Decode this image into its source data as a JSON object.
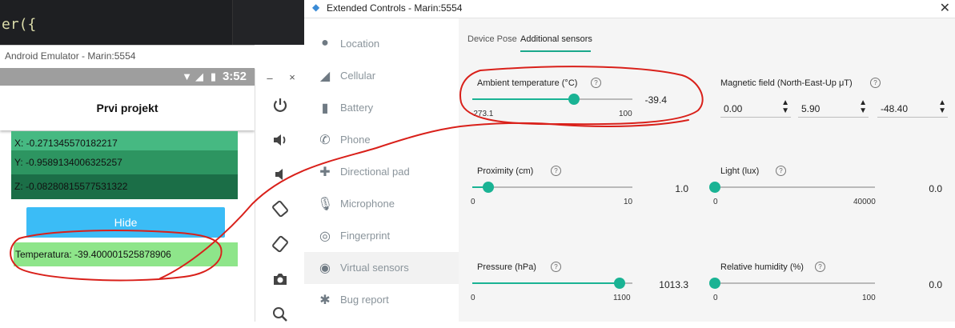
{
  "editor": {
    "code_text": "er({"
  },
  "emulator": {
    "title": "Android Emulator - Marin:5554",
    "status_time": "3:52",
    "app_title": "Prvi projekt",
    "rows": {
      "x": "X: -0.271345570182217",
      "y": "Y: -0.9589134006325257",
      "z": "Z: -0.08280815577531322"
    },
    "hide_button": "Hide",
    "temperature_text": "Temperatura: -39.400001525878906"
  },
  "toolbar": {
    "minimize": "–",
    "close": "×",
    "icons": [
      "power-icon",
      "volume-up-icon",
      "volume-down-icon",
      "rotate-left-icon",
      "rotate-right-icon",
      "camera-icon",
      "zoom-icon"
    ]
  },
  "extended": {
    "title": "Extended Controls - Marin:5554",
    "close": "✕",
    "sidebar": [
      {
        "label": "Location",
        "icon": "location-pin-icon"
      },
      {
        "label": "Cellular",
        "icon": "signal-icon"
      },
      {
        "label": "Battery",
        "icon": "battery-icon"
      },
      {
        "label": "Phone",
        "icon": "phone-icon"
      },
      {
        "label": "Directional pad",
        "icon": "dpad-icon"
      },
      {
        "label": "Microphone",
        "icon": "microphone-icon"
      },
      {
        "label": "Fingerprint",
        "icon": "fingerprint-icon"
      },
      {
        "label": "Virtual sensors",
        "icon": "sensors-icon",
        "active": true
      },
      {
        "label": "Bug report",
        "icon": "bug-icon"
      }
    ],
    "tabs": {
      "device_pose": "Device Pose",
      "additional": "Additional sensors"
    },
    "sensors": {
      "ambient": {
        "label": "Ambient temperature (°C)",
        "min": "-273.1",
        "max": "100",
        "value": "-39.4",
        "level": 0.6327
      },
      "magnetic": {
        "label": "Magnetic field (North-East-Up μT)",
        "values": [
          "0.00",
          "5.90",
          "-48.40"
        ]
      },
      "proximity": {
        "label": "Proximity (cm)",
        "min": "0",
        "max": "10",
        "value": "1.0",
        "level": 0.1
      },
      "light": {
        "label": "Light (lux)",
        "min": "0",
        "max": "40000",
        "value": "0.0",
        "level": 0.0
      },
      "pressure": {
        "label": "Pressure (hPa)",
        "min": "0",
        "max": "1100",
        "value": "1013.3",
        "level": 0.9212
      },
      "humidity": {
        "label": "Relative humidity (%)",
        "min": "0",
        "max": "100",
        "value": "0.0",
        "level": 0.0
      }
    },
    "help_glyph": "?"
  },
  "colors": {
    "accent": "#1ab394",
    "annotation": "#d9201a",
    "hide_button": "#3bbcf6",
    "temp_box": "#8ee58a"
  }
}
